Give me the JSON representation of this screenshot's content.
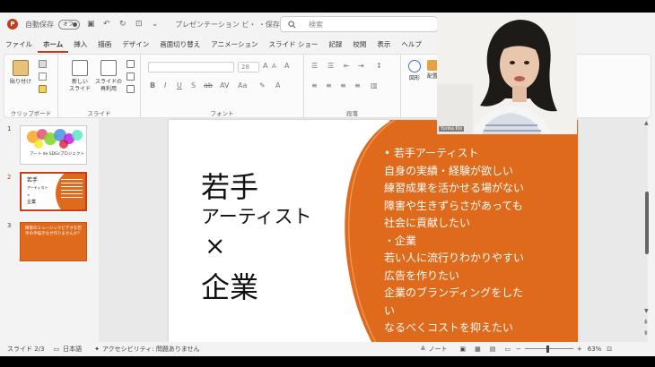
{
  "titlebar": {
    "autosave_label": "自動保存",
    "autosave_state": "オフ",
    "doc_title": "プレゼンテーション ビ・ ・保存済み ∨",
    "search_placeholder": "検索"
  },
  "menu": [
    "ファイル",
    "ホーム",
    "挿入",
    "描画",
    "デザイン",
    "画面切り替え",
    "アニメーション",
    "スライド ショー",
    "記録",
    "校閲",
    "表示",
    "ヘルプ"
  ],
  "ribbon": {
    "paste": "貼り付け",
    "clipboard": "クリップボード",
    "new_slide_1": "新しい",
    "new_slide_2": "スライド",
    "reuse_1": "スライドの",
    "reuse_2": "再利用",
    "slide_group": "スライド",
    "font_group": "フォント",
    "font_size": "28",
    "paragraph_group": "段落",
    "shapes": "図形",
    "arrange": "配置"
  },
  "thumbnails": [
    {
      "num": "1",
      "caption": "アート de SDGsプロジェクト"
    },
    {
      "num": "2",
      "l1": "若手",
      "l2": "アーティスト",
      "l3": "×",
      "l4": "企業"
    },
    {
      "num": "3",
      "text": "障害のミュージックビデオを若手の手描きなぜ作りませんか？"
    }
  ],
  "slide": {
    "title_line1": "若手",
    "title_line2": "アーティスト",
    "title_line3": "×",
    "title_line4": "企業",
    "bullets": [
      "• 若手アーティスト",
      "自身の実績・経験が欲しい",
      "練習成果を活かせる場がない",
      "障害や生きずらさがあっても",
      "社会に貢献したい",
      "・企業",
      "若い人に流行りわかりやすい",
      "広告を作りたい",
      "企業のブランディングをした",
      "い",
      "なるべくコストを抑えたい"
    ],
    "accent": "#e06a1b"
  },
  "status": {
    "slide_count": "スライド 2/3",
    "language": "日本語",
    "accessibility": "アクセシビリティ: 問題ありません",
    "notes": "ノート",
    "zoom": "63%"
  },
  "webcam": {
    "name_tag": "Yurika Kin"
  }
}
